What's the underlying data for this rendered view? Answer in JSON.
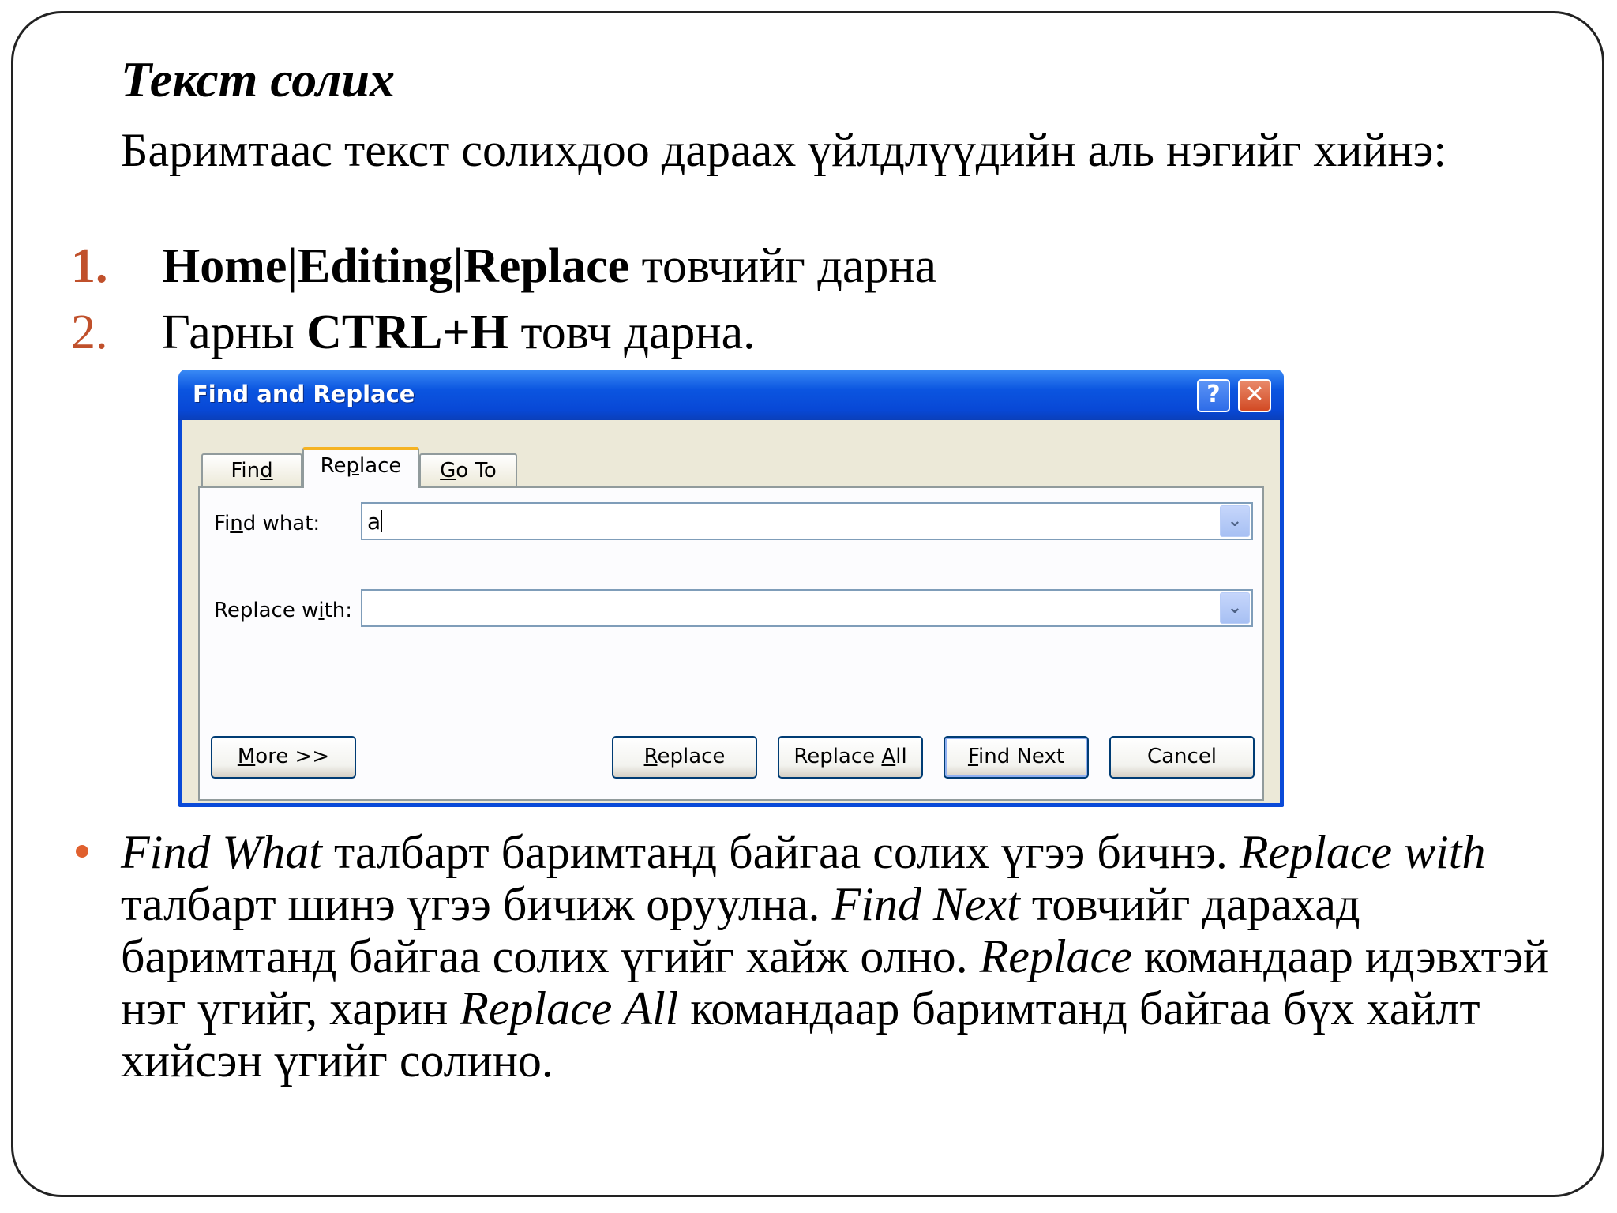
{
  "slide": {
    "title": "Текст  солих",
    "intro": "Баримтаас текст солихдоо дараах үйлдлүүдийн аль нэгийг хийнэ:",
    "steps": [
      {
        "num": "1.",
        "bold": "Home|Editing|Replace",
        "rest": " товчийг дарна"
      },
      {
        "num": "2.",
        "pre": "Гарны ",
        "bold": "CTRL+H",
        "rest": " товч дарна."
      }
    ]
  },
  "dialog": {
    "title": "Find and Replace",
    "help_glyph": "?",
    "close_glyph": "✕",
    "tabs": [
      {
        "pre": "Fin",
        "key": "d",
        "post": ""
      },
      {
        "pre": "Re",
        "key": "p",
        "post": "lace"
      },
      {
        "pre": "",
        "key": "G",
        "post": "o To"
      }
    ],
    "find_label": {
      "pre": "Fi",
      "key": "n",
      "post": "d what:"
    },
    "find_value": "a",
    "replace_label": {
      "pre": "Replace w",
      "key": "i",
      "post": "th:"
    },
    "replace_value": "",
    "dropdown_glyph": "⌄",
    "buttons": {
      "more": {
        "pre": "",
        "key": "M",
        "post": "ore >>"
      },
      "replace": {
        "pre": "",
        "key": "R",
        "post": "eplace"
      },
      "replace_all": {
        "pre": "Replace ",
        "key": "A",
        "post": "ll"
      },
      "find_next": {
        "pre": "",
        "key": "F",
        "post": "ind Next"
      },
      "cancel": "Cancel"
    }
  },
  "description": {
    "s1_italic": "Find What",
    "s1_text": " талбарт баримтанд байгаа солих үгээ бичнэ. ",
    "s2_italic": "Replace with",
    "s2_text": " талбарт шинэ үгээ бичиж оруулна. ",
    "s3_italic": "Find Next",
    "s3_text": " товчийг дарахад баримтанд байгаа солих үгийг хайж олно. ",
    "s4_italic": "Replace",
    "s4_text": " командаар идэвхтэй нэг үгийг, харин ",
    "s5_italic": "Replace All",
    "s5_text": " командаар баримтанд байгаа бүх хайлт хийсэн үгийг солино."
  },
  "colors": {
    "number": "#c0502b",
    "bullet": "#e0602e",
    "titlebar": "#0a4ad8",
    "dialog_bg": "#ece9d8"
  }
}
